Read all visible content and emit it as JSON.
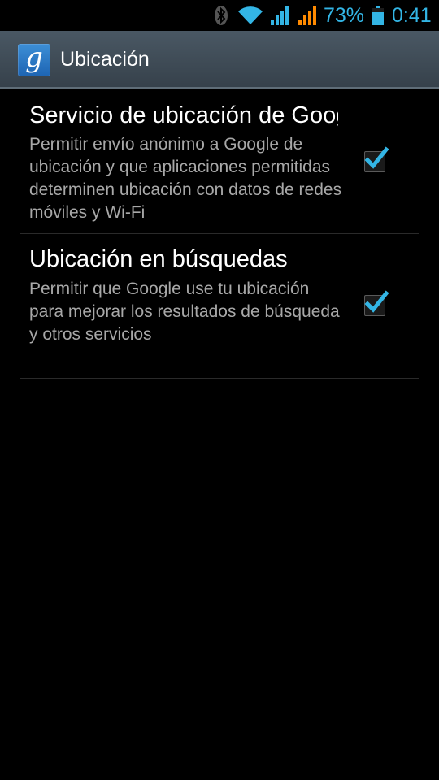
{
  "status_bar": {
    "battery_percent": "73%",
    "time": "0:41",
    "icons": [
      "bluetooth-icon",
      "wifi-icon",
      "signal-icon",
      "signal-roaming-icon",
      "battery-icon"
    ],
    "accent_color": "#33b5e5",
    "roaming_color": "#ff8a00"
  },
  "action_bar": {
    "app_icon_letter": "g",
    "title": "Ubicación"
  },
  "preferences": [
    {
      "title": "Servicio de ubicación de Google",
      "summary": "Permitir envío anónimo a Google de ubicación y que aplicaciones permitidas determinen ubicación con datos de redes móviles y Wi-Fi",
      "checked": true
    },
    {
      "title": "Ubicación en búsquedas",
      "summary": "Permitir que Google use tu ubicación para mejorar los resultados de búsqueda y otros servicios",
      "checked": true
    }
  ]
}
